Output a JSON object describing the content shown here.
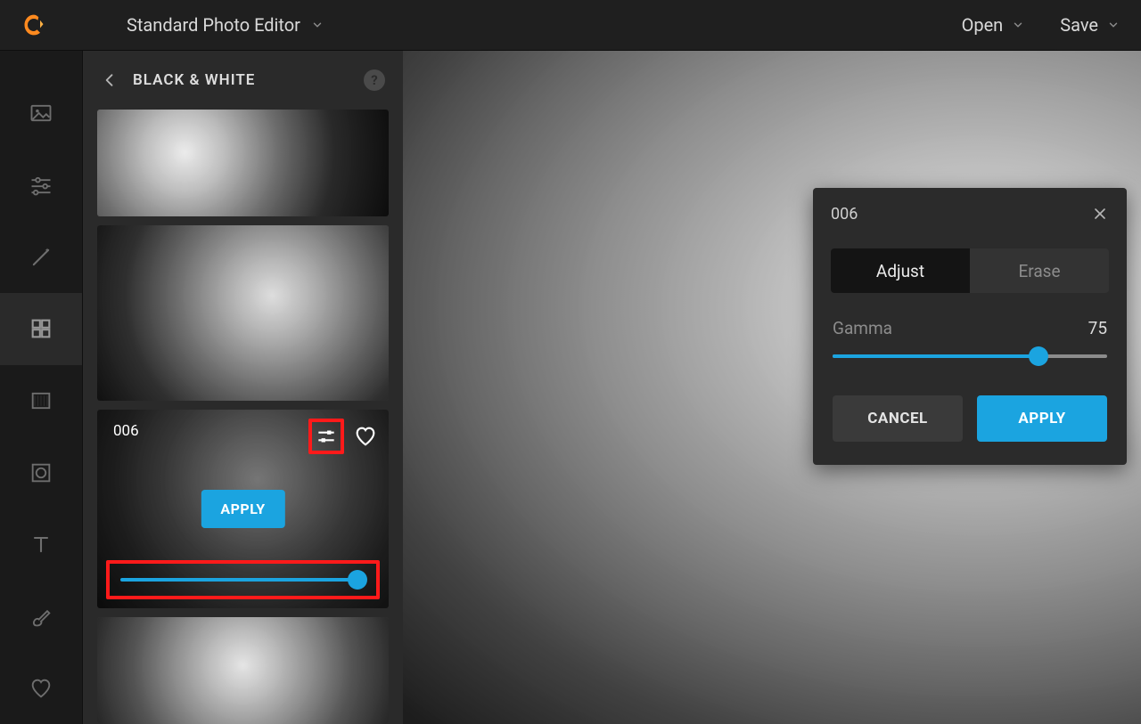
{
  "header": {
    "app_title": "Standard Photo Editor",
    "open_label": "Open",
    "save_label": "Save"
  },
  "panel": {
    "title": "BLACK & WHITE"
  },
  "thumbs": {
    "selected_label": "006",
    "apply_label": "APPLY"
  },
  "popup": {
    "title": "006",
    "tab_adjust": "Adjust",
    "tab_erase": "Erase",
    "gamma_label": "Gamma",
    "gamma_value": "75",
    "cancel_label": "CANCEL",
    "apply_label": "APPLY"
  },
  "colors": {
    "accent": "#1ba4e0",
    "highlight": "#ff1a1a"
  }
}
